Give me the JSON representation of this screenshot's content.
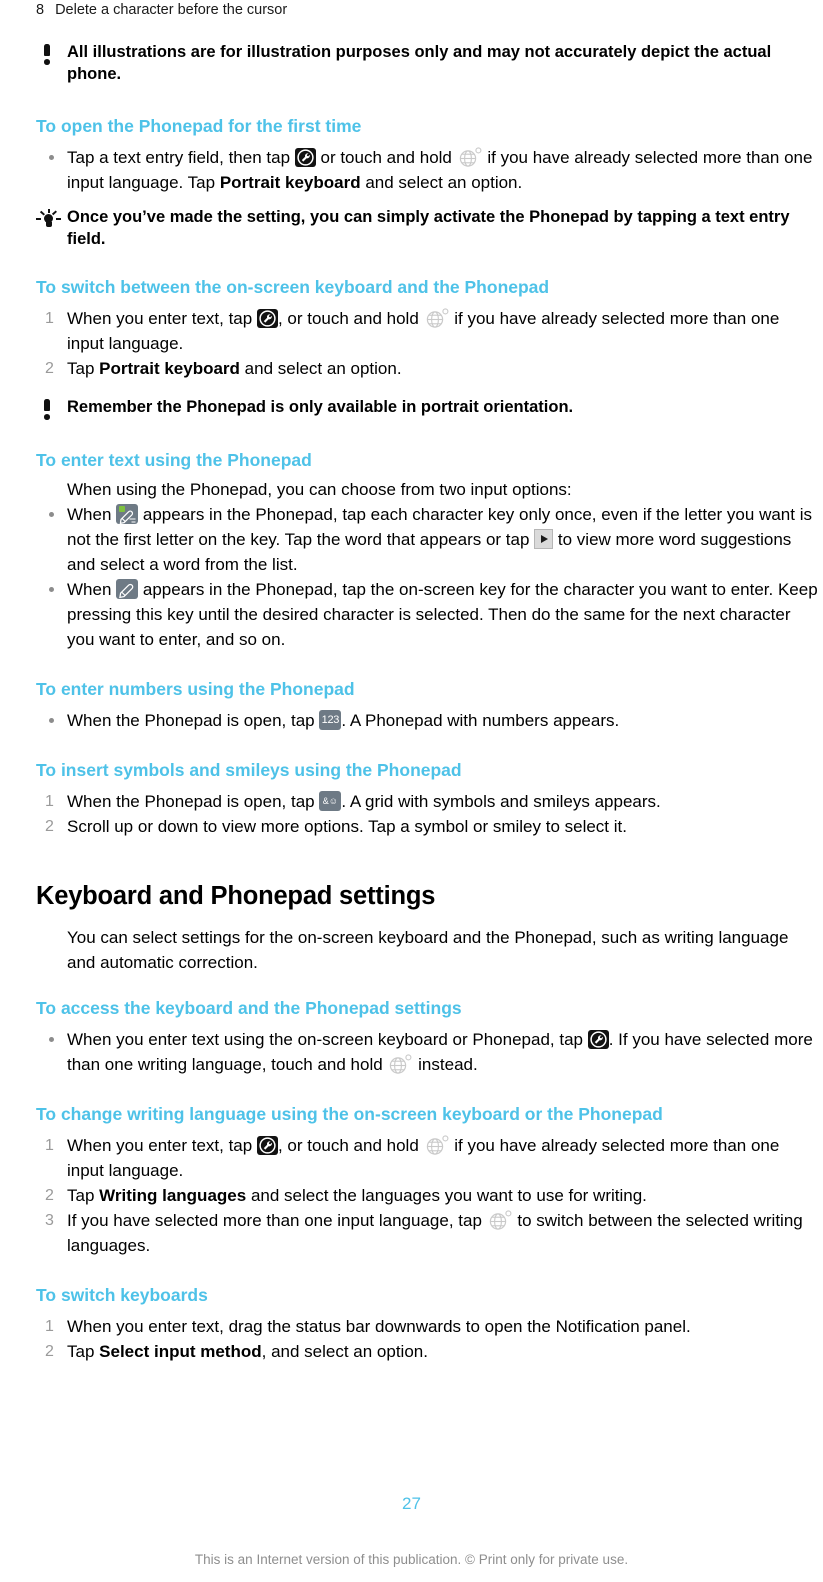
{
  "document": {
    "running_header": {
      "number": "8",
      "text": "Delete a character before the cursor"
    },
    "page_number": "27",
    "footer_note": "This is an Internet version of this publication. © Print only for private use."
  },
  "notes": {
    "illustration_note": "All illustrations are for illustration purposes only and may not accurately depict the actual phone.",
    "tip_phonepad": "Once you’ve made the setting, you can simply activate the Phonepad by tapping a text entry field.",
    "note_portrait": "Remember the Phonepad is only available in portrait orientation."
  },
  "sections": {
    "open_phonepad": {
      "title": "To open the Phonepad for the first time",
      "step1_a": "Tap a text entry field, then tap",
      "step1_b": "or touch and hold",
      "step1_c": "if you have already selected more than one input language. Tap",
      "step1_bold": "Portrait keyboard",
      "step1_d": "and select an option."
    },
    "switch_keyboard": {
      "title": "To switch between the on-screen keyboard and the Phonepad",
      "step1_a": "When you enter text, tap",
      "step1_b": ", or touch and hold",
      "step1_c": "if you have already selected more than one input language.",
      "step2_a": "Tap",
      "step2_bold": "Portrait keyboard",
      "step2_b": "and select an option.",
      "num1": "1",
      "num2": "2"
    },
    "enter_text": {
      "title": "To enter text using the Phonepad",
      "intro": "When using the Phonepad, you can choose from two input options:",
      "b1_a": "When",
      "b1_b": "appears in the Phonepad, tap each character key only once, even if the letter you want is not the first letter on the key. Tap the word that appears or tap",
      "b1_c": "to view more word suggestions and select a word from the list.",
      "b2_a": "When",
      "b2_b": "appears in the Phonepad, tap the on-screen key for the character you want to enter. Keep pressing this key until the desired character is selected. Then do the same for the next character you want to enter, and so on."
    },
    "enter_numbers": {
      "title": "To enter numbers using the Phonepad",
      "b1_a": "When the Phonepad is open, tap",
      "b1_b": ". A Phonepad with numbers appears."
    },
    "insert_symbols": {
      "title": "To insert symbols and smileys using the Phonepad",
      "num1": "1",
      "num2": "2",
      "step1_a": "When the Phonepad is open, tap",
      "step1_b": ". A grid with symbols and smileys appears.",
      "step2": "Scroll up or down to view more options. Tap a symbol or smiley to select it."
    },
    "keyboard_settings": {
      "title": "Keyboard and Phonepad settings",
      "intro": "You can select settings for the on-screen keyboard and the Phonepad, such as writing language and automatic correction."
    },
    "access_settings": {
      "title": "To access the keyboard and the Phonepad settings",
      "b1_a": "When you enter text using the on-screen keyboard or Phonepad, tap",
      "b1_b": ". If you have selected more than one writing language, touch and hold",
      "b1_c": "instead."
    },
    "change_language": {
      "title": "To change writing language using the on-screen keyboard or the Phonepad",
      "num1": "1",
      "num2": "2",
      "num3": "3",
      "step1_a": "When you enter text, tap",
      "step1_b": ", or touch and hold",
      "step1_c": "if you have already selected more than one input language.",
      "step2_a": "Tap",
      "step2_bold": "Writing languages",
      "step2_b": "and select the languages you want to use for writing.",
      "step3_a": "If you have selected more than one input language, tap",
      "step3_b": "to switch between the selected writing languages."
    },
    "switch_keyboards": {
      "title": "To switch keyboards",
      "num1": "1",
      "num2": "2",
      "step1": "When you enter text, drag the status bar downwards to open the Notification panel.",
      "step2_a": "Tap",
      "step2_bold": "Select input method",
      "step2_b": ", and select an option."
    }
  },
  "icons": {
    "wrench_key": "wrench-settings-key-icon",
    "globe_key": "globe-language-key-icon",
    "numbers_key_label": "123",
    "symbols_key_label": "&",
    "pencil_prediction_key": "pencil-prediction-key-icon",
    "pencil_multitap_key": "pencil-multitap-key-icon",
    "arrow_key": "right-arrow-key-icon",
    "note_icon": "exclamation-note-icon",
    "tip_icon": "lightbulb-tip-icon"
  },
  "colors": {
    "heading_blue": "#4ec2e8",
    "marker_grey": "#9a9a9a",
    "key_grey": "#6e7a85",
    "green_dot": "#7ec13f",
    "footer_grey": "#8e8e8e"
  }
}
